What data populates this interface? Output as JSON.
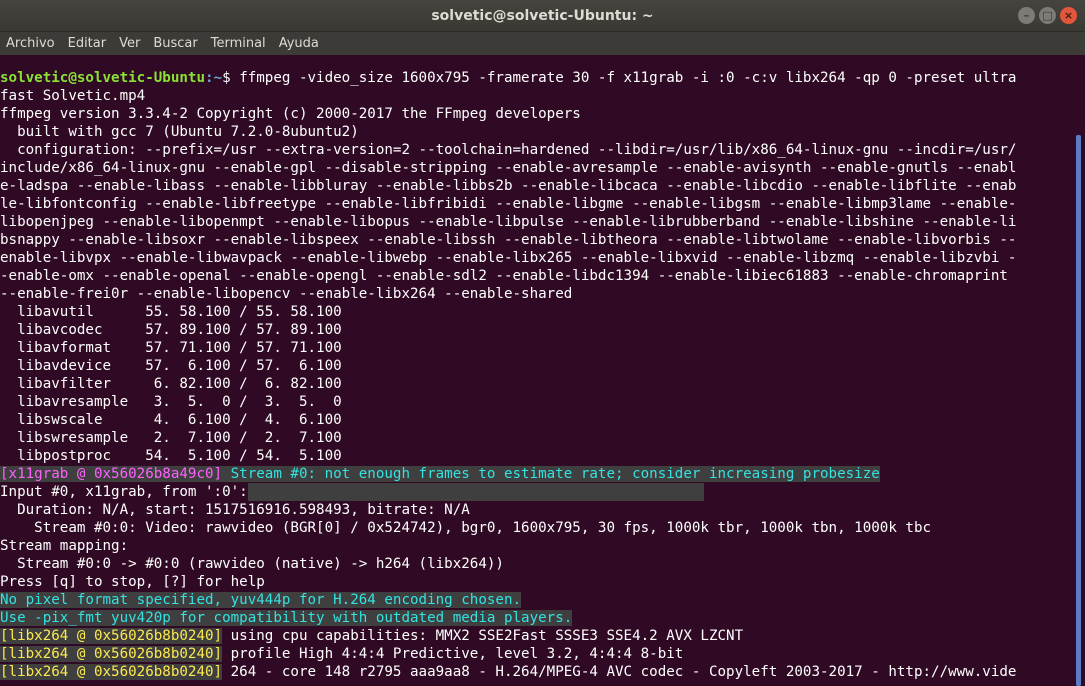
{
  "window": {
    "title": "solvetic@solvetic-Ubuntu: ~",
    "minimize_glyph": "–",
    "maximize_glyph": "□",
    "close_glyph": "×"
  },
  "menu": [
    "Archivo",
    "Editar",
    "Ver",
    "Buscar",
    "Terminal",
    "Ayuda"
  ],
  "prompt": {
    "user_host": "solvetic@solvetic-Ubuntu",
    "path": ":~",
    "symbol": "$ ",
    "command": "ffmpeg -video_size 1600x795 -framerate 30 -f x11grab -i :0 -c:v libx264 -qp 0 -preset ultra"
  },
  "terminal_lines": [
    "fast Solvetic.mp4",
    "ffmpeg version 3.3.4-2 Copyright (c) 2000-2017 the FFmpeg developers",
    "  built with gcc 7 (Ubuntu 7.2.0-8ubuntu2)",
    "  configuration: --prefix=/usr --extra-version=2 --toolchain=hardened --libdir=/usr/lib/x86_64-linux-gnu --incdir=/usr/",
    "include/x86_64-linux-gnu --enable-gpl --disable-stripping --enable-avresample --enable-avisynth --enable-gnutls --enabl",
    "e-ladspa --enable-libass --enable-libbluray --enable-libbs2b --enable-libcaca --enable-libcdio --enable-libflite --enab",
    "le-libfontconfig --enable-libfreetype --enable-libfribidi --enable-libgme --enable-libgsm --enable-libmp3lame --enable-",
    "libopenjpeg --enable-libopenmpt --enable-libopus --enable-libpulse --enable-librubberband --enable-libshine --enable-li",
    "bsnappy --enable-libsoxr --enable-libspeex --enable-libssh --enable-libtheora --enable-libtwolame --enable-libvorbis --",
    "enable-libvpx --enable-libwavpack --enable-libwebp --enable-libx265 --enable-libxvid --enable-libzmq --enable-libzvbi -",
    "-enable-omx --enable-openal --enable-opengl --enable-sdl2 --enable-libdc1394 --enable-libiec61883 --enable-chromaprint",
    "--enable-frei0r --enable-libopencv --enable-libx264 --enable-shared",
    "  libavutil      55. 58.100 / 55. 58.100",
    "  libavcodec     57. 89.100 / 57. 89.100",
    "  libavformat    57. 71.100 / 57. 71.100",
    "  libavdevice    57.  6.100 / 57.  6.100",
    "  libavfilter     6. 82.100 /  6. 82.100",
    "  libavresample   3.  5.  0 /  3.  5.  0",
    "  libswscale      4.  6.100 /  4.  6.100",
    "  libswresample   2.  7.100 /  2.  7.100",
    "  libpostproc    54.  5.100 / 54.  5.100"
  ],
  "x11grab_warning": {
    "tag": "[x11grab @ 0x56026b8a49c0]",
    "message": " Stream #0: not enough frames to estimate rate; consider increasing probesize"
  },
  "input_lines": [
    "Input #0, x11grab, from ':0':",
    "  Duration: N/A, start: 1517516916.598493, bitrate: N/A",
    "    Stream #0:0: Video: rawvideo (BGR[0] / 0x524742), bgr0, 1600x795, 30 fps, 1000k tbr, 1000k tbn, 1000k tbc",
    "Stream mapping:",
    "  Stream #0:0 -> #0:0 (rawvideo (native) -> h264 (libx264))",
    "Press [q] to stop, [?] for help"
  ],
  "pix_lines": [
    "No pixel format specified, yuv444p for H.264 encoding chosen.",
    "Use -pix_fmt yuv420p for compatibility with outdated media players."
  ],
  "libx264_lines": [
    {
      "tag": "[libx264 @ 0x56026b8b0240]",
      "message": " using cpu capabilities: MMX2 SSE2Fast SSSE3 SSE4.2 AVX LZCNT"
    },
    {
      "tag": "[libx264 @ 0x56026b8b0240]",
      "message": " profile High 4:4:4 Predictive, level 3.2, 4:4:4 8-bit"
    },
    {
      "tag": "[libx264 @ 0x56026b8b0240]",
      "message": " 264 - core 148 r2795 aaa9aa8 - H.264/MPEG-4 AVC codec - Copyleft 2003-2017 - http://www.vide"
    }
  ],
  "colors": {
    "background": "#300a24",
    "prompt_user": "#8ae234",
    "prompt_path": "#729fcf",
    "warning_tag": "#ff60ff",
    "info_text": "#34e2e2",
    "libx264_tag": "#fce94f"
  }
}
